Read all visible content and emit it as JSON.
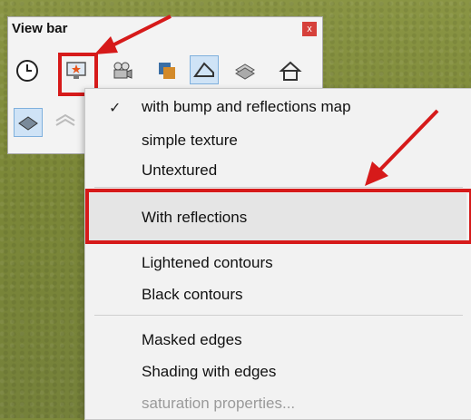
{
  "panel": {
    "title": "View bar",
    "close_label": "x"
  },
  "menu": {
    "items": [
      {
        "label": "with bump and reflections map",
        "checked": true
      },
      {
        "label": "simple texture"
      },
      {
        "label": "Untextured"
      },
      {
        "label": "With reflections",
        "highlighted": true
      },
      {
        "label": "Lightened contours"
      },
      {
        "label": "Black contours"
      },
      {
        "label": "Masked edges"
      },
      {
        "label": "Shading with edges"
      },
      {
        "label": "saturation properties...",
        "disabled": true
      }
    ],
    "check_mark": "✓"
  },
  "colors": {
    "annotation_red": "#d61a1a",
    "grass": "#7e8a3a"
  }
}
